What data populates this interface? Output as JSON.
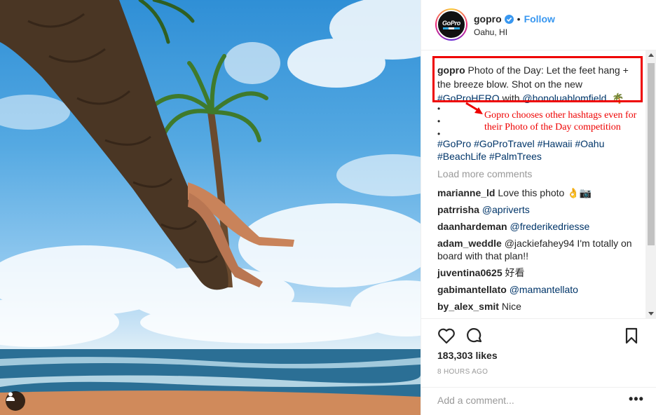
{
  "post": {
    "username": "gopro",
    "follow_label": "Follow",
    "dot": "•",
    "location": "Oahu, HI",
    "avatar_text": "GoPro"
  },
  "caption": {
    "user": "gopro",
    "text_1": " Photo of the Day: Let the feet hang + the breeze blow. Shot on the new ",
    "tag_1": "#GoProHERO",
    "text_2": " with ",
    "tag_2": "@honoluablomfield",
    "text_3": ". 🌴",
    "dots": [
      "•",
      "•",
      "•"
    ],
    "hashtags": "#GoPro #GoProTravel #Hawaii #Oahu #BeachLife #PalmTrees"
  },
  "annotation": {
    "text": "Gopro chooses other hashtags even for their Photo of the Day competition",
    "color": "#e00000"
  },
  "load_more": "Load more comments",
  "comments": [
    {
      "user": "marianne_ld",
      "text": "Love this photo 👌📷"
    },
    {
      "user": "patrrisha",
      "text": "@apriverts"
    },
    {
      "user": "daanhardeman",
      "text": "@frederikedriesse"
    },
    {
      "user": "adam_weddle",
      "text": "@jackiefahey94 I'm totally on board with that plan!!"
    },
    {
      "user": "juventina0625",
      "text": "好看"
    },
    {
      "user": "gabimantellato",
      "text": "@mamantellato"
    },
    {
      "user": "by_alex_smit",
      "text": "Nice"
    }
  ],
  "likes": "183,303 likes",
  "time_ago": "8 HOURS AGO",
  "add_comment_placeholder": "Add a comment...",
  "more_label": "•••",
  "colors": {
    "link": "#3897f0",
    "tag": "#003569",
    "muted": "#999999"
  }
}
